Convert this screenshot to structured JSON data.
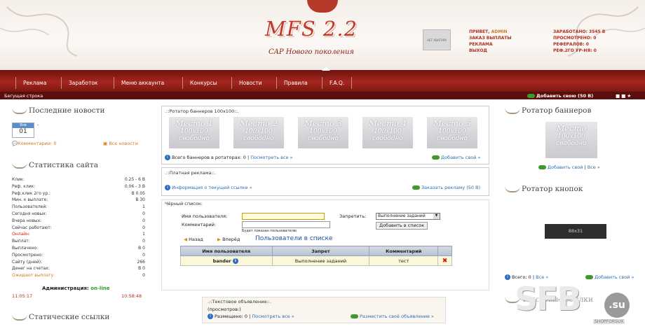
{
  "header": {
    "logo": "MFS 2.2",
    "slogan": "CAP Нового поколения",
    "avatar_text": "НЕТ АВАТАРА",
    "user_lines": [
      {
        "label": "ПРИВЕТ, ",
        "value": "ADMIN"
      },
      {
        "label": "ЗАКАЗ ВЫПЛАТЫ",
        "value": ""
      },
      {
        "label": "РЕКЛАМА",
        "value": ""
      },
      {
        "label": "ВЫХОД",
        "value": ""
      }
    ],
    "stats_lines": [
      {
        "label": "ЗАРАБОТАНО: ",
        "value": "3545 В"
      },
      {
        "label": "ПРОСМОТРЕНО: ",
        "value": "0"
      },
      {
        "label": "РЕФЕРАЛОВ: ",
        "value": "0"
      },
      {
        "label": "РЕФ.2ГО УР-НЯ: ",
        "value": "0"
      }
    ]
  },
  "nav": {
    "items": [
      "Реклама",
      "Заработок",
      "Меню аккаунта",
      "Конкурсы",
      "Новости",
      "Правила",
      "F.A.Q."
    ]
  },
  "ticker": {
    "label": "Бегущая строка",
    "add_link": "Добавить свою (50 В)"
  },
  "left": {
    "news_title": "Последние новости",
    "news_month": "Янв",
    "news_day": "01",
    "news_dash": "-",
    "comments": "Комментарии: 0",
    "all_news": "Все новости",
    "stats_title": "Статистика сайта",
    "stats": [
      {
        "label": "Клик:",
        "value": "0.25 - 6 В"
      },
      {
        "label": "Реф. клик:",
        "value": "0.06 - 3 В"
      },
      {
        "label": "Реф.клик 2го ур.:",
        "value": "В 0.05"
      },
      {
        "label": "Мин. к выплате:",
        "value": "В 30"
      },
      {
        "label": "Пользователей:",
        "value": "1"
      },
      {
        "label": "Сегодня новых:",
        "value": "0"
      },
      {
        "label": "Вчера новых:",
        "value": "0"
      },
      {
        "label": "Сейчас работают:",
        "value": "0"
      },
      {
        "label": "Онлайн:",
        "value": "1"
      },
      {
        "label": "Выплат:",
        "value": "0"
      },
      {
        "label": "Выплачено:",
        "value": "В 0"
      },
      {
        "label": "Просмотрено:",
        "value": "0"
      },
      {
        "label": "Сайту (дней):",
        "value": "266"
      },
      {
        "label": "Денег на счетах:",
        "value": "В 0"
      },
      {
        "label": "Ожидают выплату:",
        "value": "0"
      }
    ],
    "admin_label": "Администрация:",
    "admin_status": "on-line",
    "time_left": "11:05:17",
    "time_right": "10:58:48",
    "static_title": "Статические ссылки"
  },
  "center": {
    "rotator_title": ".::Ротатор баннеров 100x100::.",
    "banner_line1": [
      "Место 1",
      "Место 2",
      "Место 3",
      "Место 4",
      "Место 5"
    ],
    "banner_line2": "100x100",
    "banner_line3": "свободно",
    "rotator_total": "Всего баннеров в ротаторах: 0",
    "view_all": "Посмотреть все »",
    "add_own": "Добавить свой »",
    "paid_title": ".::Платная реклама::.",
    "paid_info": "Информация о текущей ссылке »",
    "paid_order": "Заказать рекламу (50 В)",
    "bl_title": "Чёрный список:",
    "bl_user_label": "Имя пользователя:",
    "bl_comment_label": "Комментарий:",
    "bl_forbid_label": "Запретить:",
    "bl_select": "Выполнение заданий",
    "bl_add_btn": "Добавить в список",
    "bl_hint": "Будет показан пользователю",
    "bl_back": "Назад",
    "bl_forward": "Вперёд",
    "bl_heading": "Пользователи в списке",
    "bl_headers": [
      "Имя пользователя",
      "Запрет",
      "Комментарий"
    ],
    "bl_rows": [
      {
        "user": "bander",
        "ban": "Выполнение заданий",
        "comment": "тест"
      }
    ],
    "text_ad_title": ".::Текстовое объявление::.",
    "text_ad_views": "(просмотров:)",
    "text_ad_placed": "Размещено: 0",
    "text_ad_view_all": "Посмотреть все »",
    "text_ad_place": "Разместить своё объявление »"
  },
  "right": {
    "rotator_title": "Ротатор баннеров",
    "banner_l1": "Место",
    "banner_l2": "100x100",
    "banner_l3": "свободно",
    "add_own": "Добавить свой",
    "sep": "|",
    "all": "Все »",
    "buttons_title": "Ротатор кнопок",
    "button_box": "88x31",
    "total": "Всего: 0",
    "all2": "Все »",
    "add_own2": "Добавить свой »",
    "next_title": "Текстовые ссылки"
  },
  "watermark": {
    "text": "SFB",
    "domain": ".su",
    "small": "SHOPFORSUX"
  },
  "colors": {
    "accent": "#a6261d",
    "link": "#2a6fb0",
    "green": "#3e9a2c"
  }
}
